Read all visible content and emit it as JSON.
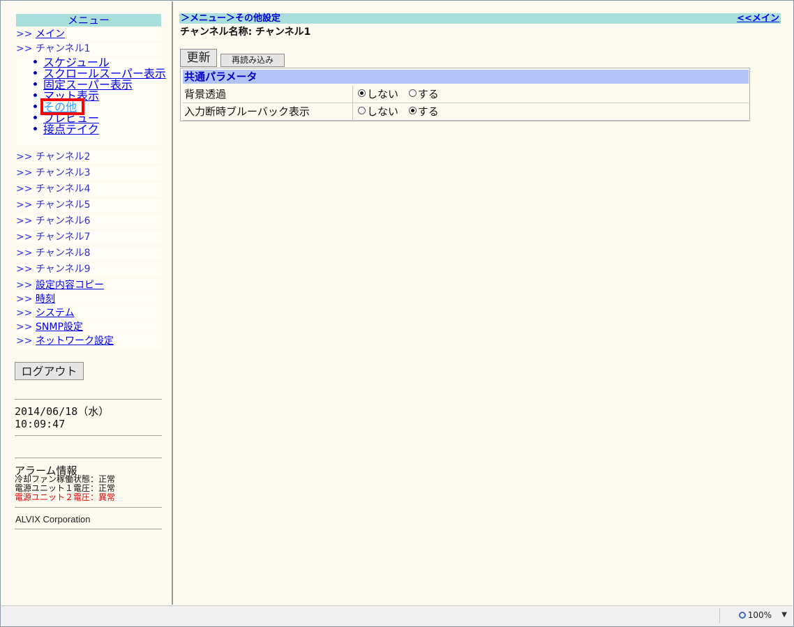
{
  "menu": {
    "title": "メニュー",
    "arrow": ">>",
    "main": "メイン",
    "channel1": "チャンネル1",
    "sub_items": [
      "スケジュール",
      "スクロールスーパー表示",
      "固定スーパー表示",
      "マット表示",
      "その他",
      "プレビュー",
      "接点テイク"
    ],
    "channels": [
      "チャンネル2",
      "チャンネル3",
      "チャンネル4",
      "チャンネル5",
      "チャンネル6",
      "チャンネル7",
      "チャンネル8",
      "チャンネル9"
    ],
    "links": [
      "設定内容コピー",
      "時刻",
      "システム",
      "SNMP設定",
      "ネットワーク設定"
    ],
    "logout": "ログアウト"
  },
  "clock": {
    "date": "2014/06/18（水）",
    "time": "10:09:47"
  },
  "alarm": {
    "title": "アラーム情報",
    "lines": [
      {
        "text": "冷却ファン稼働状態：正常",
        "status": "ok"
      },
      {
        "text": "電源ユニット１電圧：正常",
        "status": "ok"
      },
      {
        "text": "電源ユニット２電圧：異常",
        "status": "error"
      }
    ]
  },
  "footer": {
    "corp": "ALVIX Corporation"
  },
  "content": {
    "breadcrumb": "＞メニュー＞その他設定",
    "back_link": "<<メイン",
    "channel_name": "チャンネル名称: チャンネル1",
    "update_button": "更新",
    "reload_button": "再読み込み",
    "section_title": "共通パラメータ",
    "params": [
      {
        "label": "背景透過",
        "options": [
          "しない",
          "する"
        ],
        "selected": 0
      },
      {
        "label": "入力断時ブルーバック表示",
        "options": [
          "しない",
          "する"
        ],
        "selected": 1
      }
    ]
  },
  "statusbar": {
    "zoom": "100%"
  },
  "colors": {
    "header_bg": "#a8dedc",
    "section_bg": "#b4c4f4",
    "highlight": "#ff0000",
    "error_text": "#e00000",
    "page_bg": "#fdfaf0"
  }
}
